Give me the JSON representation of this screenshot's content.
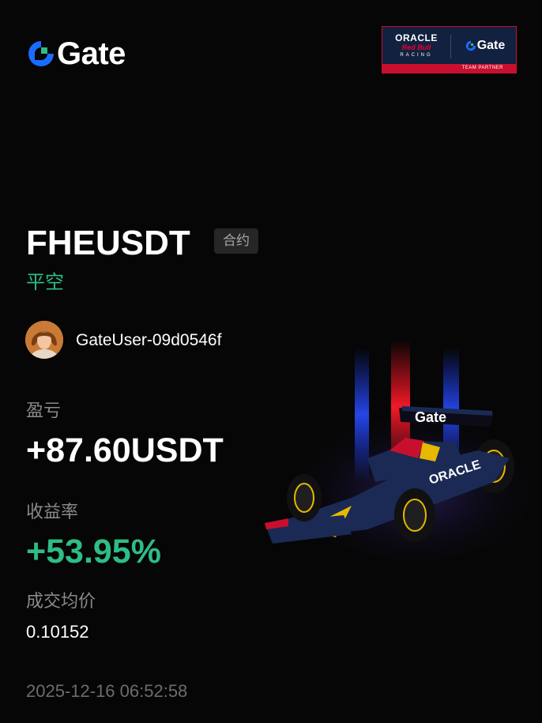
{
  "brand": {
    "logo_text": "Gate",
    "accent_blue": "#1a6bff",
    "accent_green": "#2dbd85"
  },
  "partner_badge": {
    "oracle": "ORACLE",
    "redbull": "Red Bull",
    "racing": "RACING",
    "gate": "Gate",
    "caption": "TEAM PARTNER"
  },
  "trade": {
    "symbol": "FHEUSDT",
    "market_type": "合约",
    "side": "平空"
  },
  "user": {
    "name": "GateUser-09d0546f"
  },
  "stats": {
    "pnl_label": "盈亏",
    "pnl_value": "+87.60USDT",
    "roi_label": "收益率",
    "roi_value": "+53.95%",
    "avg_price_label": "成交均价",
    "avg_price_value": "0.10152"
  },
  "timestamp": "2025-12-16 06:52:58",
  "decor": {
    "car_livery": "#1b2a55",
    "car_text": "ORACLE",
    "wing_text": "Gate"
  }
}
